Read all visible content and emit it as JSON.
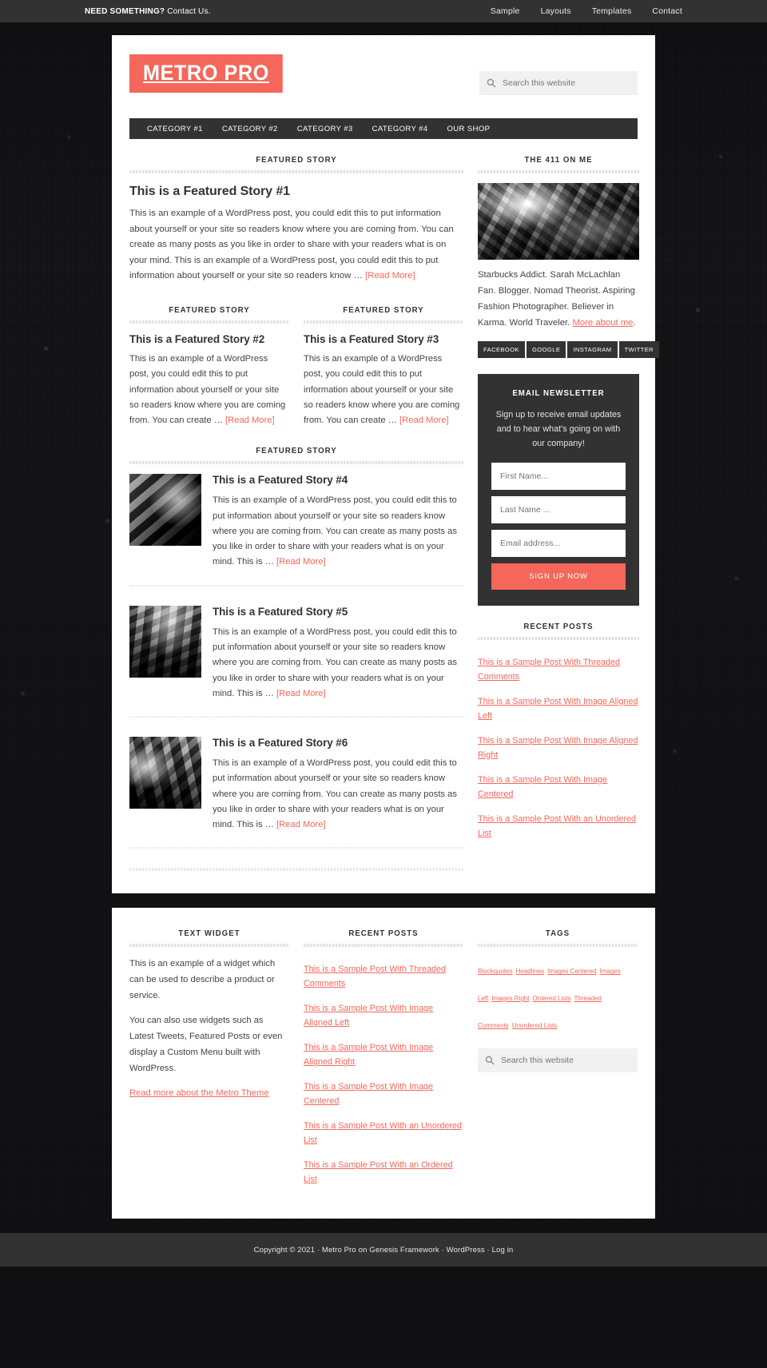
{
  "top_bar": {
    "tagline_strong": "NEED SOMETHING?",
    "tagline_link": "Contact Us.",
    "menu": [
      "Sample",
      "Layouts",
      "Templates",
      "Contact"
    ]
  },
  "header": {
    "logo": "METRO PRO",
    "search_placeholder": "Search this website",
    "search_icon": "search-icon"
  },
  "nav_primary": [
    "CATEGORY #1",
    "CATEGORY #2",
    "CATEGORY #3",
    "CATEGORY #4",
    "OUR SHOP"
  ],
  "main": {
    "featured_label": "FEATURED STORY",
    "read_more": "[Read More]",
    "ellipsis": " … ",
    "story1": {
      "title": "This is a Featured Story #1",
      "body": "This is an example of a WordPress post, you could edit this to put information about yourself or your site so readers know where you are coming from. You can create as many posts as you like in order to share with your readers what is on your mind. This is an example of a WordPress post, you could edit this to put information about yourself or your site so readers know"
    },
    "story2": {
      "title": "This is a Featured Story #2",
      "body": "This is an example of a WordPress post, you could edit this to put information about yourself or your site so readers know where you are coming from. You can create"
    },
    "story3": {
      "title": "This is a Featured Story #3",
      "body": "This is an example of a WordPress post, you could edit this to put information about yourself or your site so readers know where you are coming from. You can create"
    },
    "story4": {
      "title": "This is a Featured Story #4",
      "body": "This is an example of a WordPress post, you could edit this to put information about yourself or your site so readers know where you are coming from. You can create as many posts as you like in order to share with your readers what is on your mind. This is"
    },
    "story5": {
      "title": "This is a Featured Story #5",
      "body": "This is an example of a WordPress post, you could edit this to put information about yourself or your site so readers know where you are coming from. You can create as many posts as you like in order to share with your readers what is on your mind. This is"
    },
    "story6": {
      "title": "This is a Featured Story #6",
      "body": "This is an example of a WordPress post, you could edit this to put information about yourself or your site so readers know where you are coming from. You can create as many posts as you like in order to share with your readers what is on your mind. This is"
    }
  },
  "sidebar": {
    "about": {
      "title": "THE 411 ON ME",
      "text": "Starbucks Addict. Sarah McLachlan Fan. Blogger. Nomad Theorist. Aspiring Fashion Photographer. Believer in Karma. World Traveler. ",
      "link": "More about me",
      "link_tail": "."
    },
    "social": [
      "FACEBOOK",
      "GOOGLE",
      "INSTAGRAM",
      "TWITTER"
    ],
    "newsletter": {
      "title": "EMAIL NEWSLETTER",
      "text": "Sign up to receive email updates and to hear what's going on with our company!",
      "first_name_placeholder": "First Name...",
      "last_name_placeholder": "Last Name ...",
      "email_placeholder": "Email address...",
      "button": "SIGN UP NOW"
    },
    "recent_posts": {
      "title": "RECENT POSTS",
      "items": [
        "This is a Sample Post With Threaded Comments",
        "This is a Sample Post With Image Aligned Left",
        "This is a Sample Post With Image Aligned Right",
        "This is a Sample Post With Image Centered",
        "This is a Sample Post With an Unordered List"
      ]
    }
  },
  "footer_widgets": {
    "text_widget": {
      "title": "TEXT WIDGET",
      "p1": "This is an example of a widget which can be used to describe a product or service.",
      "p2": "You can also use widgets such as Latest Tweets, Featured Posts or even display a Custom Menu built with WordPress.",
      "link": "Read more about the Metro Theme"
    },
    "recent_posts": {
      "title": "RECENT POSTS",
      "items": [
        "This is a Sample Post With Threaded Comments",
        "This is a Sample Post With Image Aligned Left",
        "This is a Sample Post With Image Aligned Right",
        "This is a Sample Post With Image Centered",
        "This is a Sample Post With an Unordered List",
        "This is a Sample Post With an Ordered List"
      ]
    },
    "tags": {
      "title": "TAGS",
      "items": [
        "Blockquotes",
        "Headlines",
        "Images Centered",
        "Images Left",
        "Images Right",
        "Ordered Lists",
        "Threaded Comments",
        "Unordered Lists"
      ],
      "search_placeholder": "Search this website",
      "search_icon": "search-icon"
    }
  },
  "footer": {
    "copyright": "Copyright © 2021 · Metro Pro on Genesis Framework · WordPress · Log in"
  },
  "colors": {
    "accent": "#f4675a",
    "dark": "#323232",
    "text": "#444444"
  }
}
